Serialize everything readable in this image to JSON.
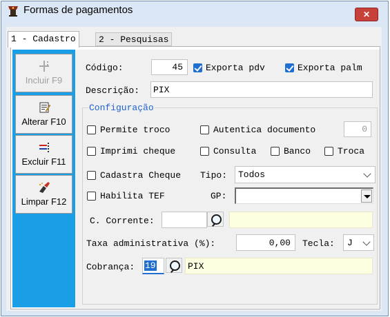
{
  "window": {
    "title": "Formas de pagamentos"
  },
  "tabs": [
    {
      "label": "1 - Cadastro"
    },
    {
      "label": "2 - Pesquisas"
    }
  ],
  "sidebar": {
    "buttons": [
      {
        "label": "Incluir F9",
        "icon": "insert-icon",
        "enabled": false
      },
      {
        "label": "Alterar F10",
        "icon": "edit-icon",
        "enabled": true
      },
      {
        "label": "Excluir F11",
        "icon": "delete-icon",
        "enabled": true
      },
      {
        "label": "Limpar F12",
        "icon": "clear-icon",
        "enabled": true
      }
    ]
  },
  "form": {
    "codigo_label": "Código:",
    "codigo_value": "45",
    "exporta_pdv_label": "Exporta pdv",
    "exporta_pdv_checked": true,
    "exporta_palm_label": "Exporta palm",
    "exporta_palm_checked": true,
    "descricao_label": "Descrição:",
    "descricao_value": "PIX"
  },
  "config": {
    "legend": "Configuração",
    "permite_troco_label": "Permite troco",
    "autentica_label": "Autentica documento",
    "autentica_value": "0",
    "imprimi_cheque_label": "Imprimi cheque",
    "consulta_label": "Consulta",
    "banco_label": "Banco",
    "troca_label": "Troca",
    "cadastra_cheque_label": "Cadastra Cheque",
    "tipo_label": "Tipo:",
    "tipo_value": "Todos",
    "habilita_tef_label": "Habilita TEF",
    "gp_label": "GP:",
    "gp_value": "",
    "c_corrente_label": "C. Corrente:",
    "c_corrente_value": "",
    "c_corrente_desc": "",
    "taxa_label": "Taxa administrativa (%):",
    "taxa_value": "0,00",
    "tecla_label": "Tecla:",
    "tecla_value": "J",
    "cobranca_label": "Cobrança:",
    "cobranca_value": "19",
    "cobranca_desc": "PIX"
  }
}
